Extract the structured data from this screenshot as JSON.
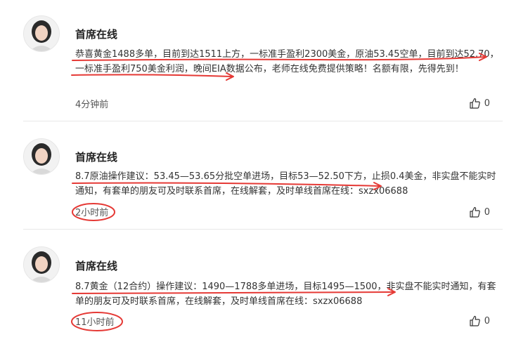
{
  "posts": [
    {
      "author": "首席在线",
      "content": "恭喜黄金1488多单，目前到达1511上方，一标准手盈利2300美金，原油53.45空单，目前到达52.70，一标准手盈利750美金利润，晚间EIA数据公布，老师在线免费提供策略！名额有限，先得先到！",
      "time": "4分钟前",
      "likes": "0"
    },
    {
      "author": "首席在线",
      "content": "8.7原油操作建议：53.45—53.65分批空单进场，目标53—52.50下方，止损0.4美金，非实盘不能实时通知，有套单的朋友可及时联系首席，在线解套，及时单线首席在线：sxzx06688",
      "time": "2小时前",
      "likes": "0"
    },
    {
      "author": "首席在线",
      "content": "8.7黄金（12合约）操作建议：1490—1788多单进场，目标1495—1500，非实盘不能实时通知，有套单的朋友可及时联系首席，在线解套，及时单线首席在线：sxzx06688",
      "time": "11小时前",
      "likes": "0"
    }
  ],
  "icons": {
    "like": "thumbs-up-icon",
    "avatar": "avatar"
  },
  "colors": {
    "annotation": "#e53935",
    "divider": "#e8e8e8",
    "text": "#333333"
  }
}
